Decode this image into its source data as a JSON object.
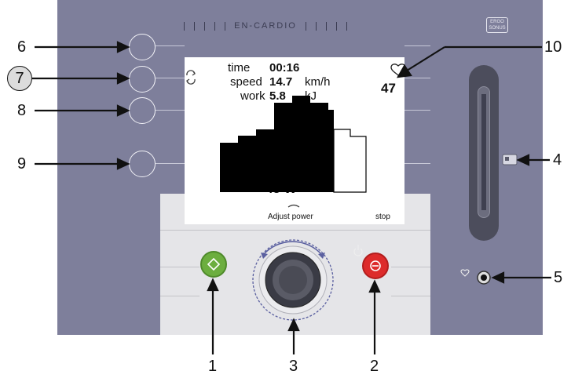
{
  "device": {
    "brand_strip": "EN-CARDIO",
    "logo_text": "ERGO SONUS"
  },
  "display": {
    "time_label": "time",
    "time_value": "00:16",
    "speed_label": "speed",
    "speed_value": "14.7",
    "speed_unit": "km/h",
    "work_label": "work",
    "work_value": "5.8",
    "work_unit": "kJ",
    "heart_rate": "47",
    "power_value": "45 W",
    "adjust_label": "Adjust power",
    "stop_label": "stop"
  },
  "callouts": {
    "c1": "1",
    "c2": "2",
    "c3": "3",
    "c4": "4",
    "c5": "5",
    "c6": "6",
    "c7": "7",
    "c8": "8",
    "c9": "9",
    "c10": "10"
  },
  "profile_bars": {
    "levels": [
      2,
      3,
      4,
      4,
      5,
      4,
      3
    ],
    "future_levels": [
      3,
      2
    ]
  },
  "colors": {
    "panel": "#7e7f9b",
    "start": "#6cae3f",
    "stop": "#dd2b2b",
    "screen": "#ffffff"
  },
  "icons": {
    "heart": "heart-outline-icon",
    "refresh": "refresh-arrows-icon",
    "start": "start-diamond-icon",
    "stop": "stop-icon",
    "power": "power-icon",
    "card": "card-reader-icon",
    "adjust": "rotate-arrows-icon"
  }
}
